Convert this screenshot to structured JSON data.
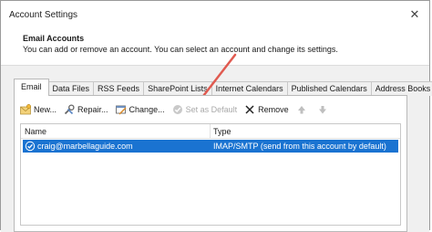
{
  "window": {
    "title": "Account Settings",
    "close_glyph": "✕"
  },
  "header": {
    "title": "Email Accounts",
    "description": "You can add or remove an account. You can select an account and change its settings."
  },
  "tabs": [
    {
      "label": "Email",
      "active": true
    },
    {
      "label": "Data Files"
    },
    {
      "label": "RSS Feeds"
    },
    {
      "label": "SharePoint Lists"
    },
    {
      "label": "Internet Calendars"
    },
    {
      "label": "Published Calendars"
    },
    {
      "label": "Address Books"
    }
  ],
  "toolbar": {
    "new_label": "New...",
    "repair_label": "Repair...",
    "change_label": "Change...",
    "set_default_label": "Set as Default",
    "remove_label": "Remove"
  },
  "grid": {
    "columns": {
      "name": "Name",
      "type": "Type"
    },
    "rows": [
      {
        "name": "craig@marbellaguide.com",
        "type": "IMAP/SMTP (send from this account by default)"
      }
    ]
  },
  "colors": {
    "selection": "#1a73d1",
    "annotation_arrow": "#e05a50"
  },
  "icons": [
    "close-icon",
    "new-account-icon",
    "repair-icon",
    "change-icon",
    "set-default-icon",
    "remove-icon",
    "move-up-icon",
    "move-down-icon",
    "default-account-check-icon"
  ]
}
